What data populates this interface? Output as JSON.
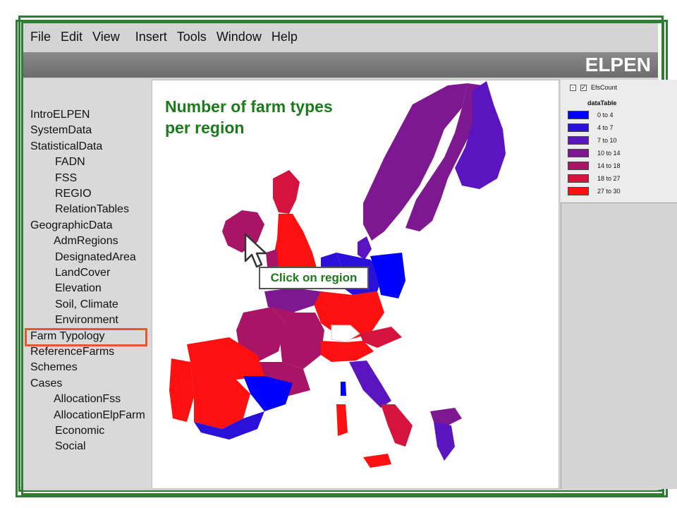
{
  "menu": [
    "File",
    "Edit",
    "View",
    "Insert",
    "Tools",
    "Window",
    "Help"
  ],
  "app_title": "ELPEN",
  "sidebar": {
    "items": [
      {
        "label": "IntroELPEN"
      },
      {
        "label": "SystemData"
      },
      {
        "label": "StatisticalData"
      },
      {
        "label": "FADN"
      },
      {
        "label": "FSS"
      },
      {
        "label": "REGIO"
      },
      {
        "label": "RelationTables"
      },
      {
        "label": "GeographicData"
      },
      {
        "label": "AdmRegions"
      },
      {
        "label": "DesignatedArea"
      },
      {
        "label": "LandCover"
      },
      {
        "label": "Elevation"
      },
      {
        "label": "Soil, Climate"
      },
      {
        "label": "Environment"
      },
      {
        "label": "Farm Typology"
      },
      {
        "label": "ReferenceFarms"
      },
      {
        "label": "Schemes"
      },
      {
        "label": "Cases"
      },
      {
        "label": "AllocationFss"
      },
      {
        "label": "AllocationElpFarm"
      },
      {
        "label": "Economic"
      },
      {
        "label": "Social"
      }
    ],
    "selected": "Farm Typology"
  },
  "map": {
    "title_line1": "Number of farm types",
    "title_line2": "per region",
    "callout": "Click on region"
  },
  "legend": {
    "layer_minus": "-",
    "layer_check": "✓",
    "layer_name": "EfsCount",
    "table_label": "dataTable",
    "classes": [
      {
        "label": "0 to 4",
        "color": "#0000ff"
      },
      {
        "label": "4 to 7",
        "color": "#2a10d8"
      },
      {
        "label": "7 to 10",
        "color": "#5a14c0"
      },
      {
        "label": "10 to 14",
        "color": "#7d1890"
      },
      {
        "label": "14 to 18",
        "color": "#a81466"
      },
      {
        "label": "18 to 27",
        "color": "#d4143c"
      },
      {
        "label": "27 to 30",
        "color": "#ff1010"
      }
    ]
  }
}
